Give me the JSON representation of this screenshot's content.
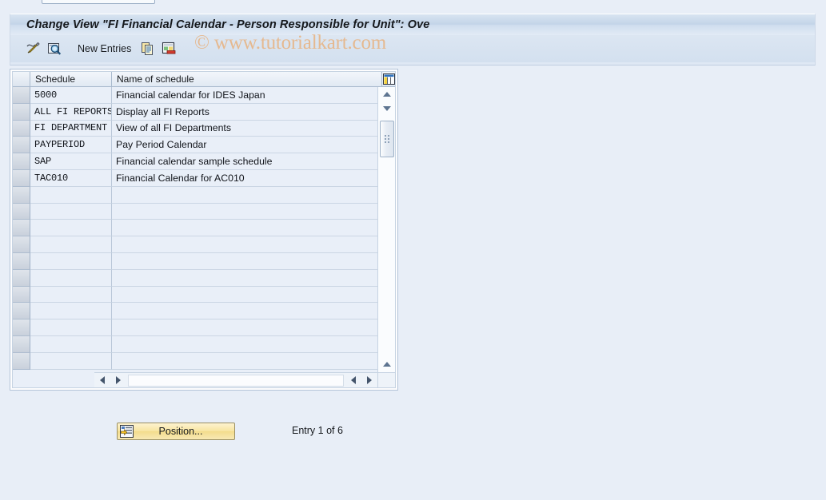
{
  "window": {
    "title": "Change View \"FI Financial Calendar - Person Responsible for Unit\": Ove"
  },
  "watermark": {
    "text": "© www.tutorialkart.com",
    "color": "#e8b07b"
  },
  "toolbar": {
    "display_change_label": "",
    "details_label": "",
    "new_entries_label": "New Entries",
    "copy_as_label": "",
    "delete_label": "",
    "icons": [
      "display-change-icon",
      "details-magnifier-icon",
      "copy-as-icon",
      "delete-row-icon"
    ]
  },
  "table": {
    "settings_icon": "table-settings-icon",
    "columns": [
      {
        "key": "schedule",
        "label": "Schedule"
      },
      {
        "key": "name",
        "label": "Name of schedule"
      }
    ],
    "rows": [
      {
        "schedule": "5000",
        "name": "Financial calendar for IDES Japan"
      },
      {
        "schedule": "ALL FI REPORTS",
        "name": "Display all FI Reports"
      },
      {
        "schedule": "FI DEPARTMENT",
        "name": "View of all FI Departments"
      },
      {
        "schedule": "PAYPERIOD",
        "name": "Pay Period Calendar"
      },
      {
        "schedule": "SAP",
        "name": "Financial calendar sample schedule"
      },
      {
        "schedule": "TAC010",
        "name": "Financial Calendar for AC010"
      }
    ],
    "empty_row_count": 11,
    "vertical_scrollbar": {
      "up_arrow": "scroll-up-icon",
      "down_arrow": "scroll-down-icon"
    },
    "horizontal_scrollbar": {
      "left_arrow": "scroll-left-icon",
      "right_arrow": "scroll-right-icon"
    }
  },
  "footer": {
    "position_button_label": "Position...",
    "position_button_icon": "position-list-icon",
    "entry_status": "Entry 1 of 6"
  },
  "colors": {
    "background": "#e8eef7",
    "title_bar": "#c3d4e8",
    "button_yellow": "#f7e49f",
    "grid_line": "#b9c7d8"
  }
}
